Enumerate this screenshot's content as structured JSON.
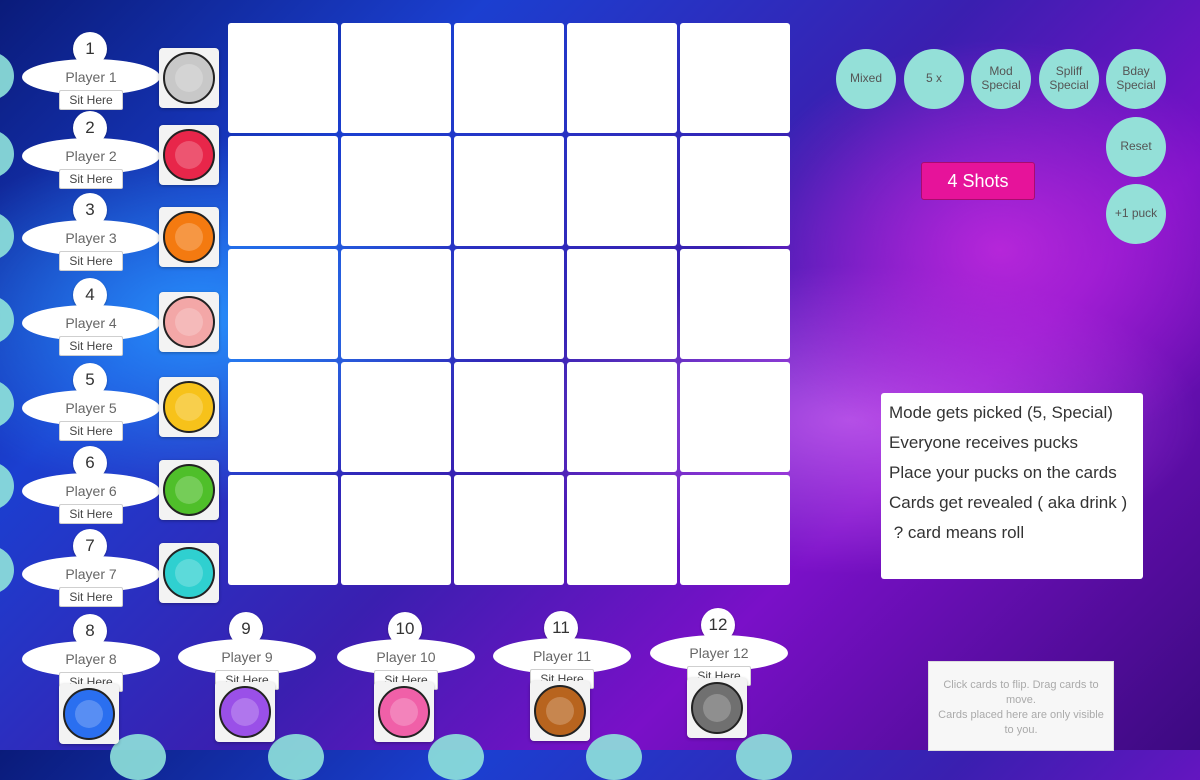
{
  "players": [
    {
      "num": "1",
      "name": "Player 1",
      "sit": "Sit Here",
      "color": "#c8c8c8"
    },
    {
      "num": "2",
      "name": "Player 2",
      "sit": "Sit Here",
      "color": "#e8264a"
    },
    {
      "num": "3",
      "name": "Player 3",
      "sit": "Sit Here",
      "color": "#f47a10"
    },
    {
      "num": "4",
      "name": "Player 4",
      "sit": "Sit Here",
      "color": "#f3a7a7"
    },
    {
      "num": "5",
      "name": "Player 5",
      "sit": "Sit Here",
      "color": "#f7c21a"
    },
    {
      "num": "6",
      "name": "Player 6",
      "sit": "Sit Here",
      "color": "#4fbf2a"
    },
    {
      "num": "7",
      "name": "Player 7",
      "sit": "Sit Here",
      "color": "#2fd0d0"
    },
    {
      "num": "8",
      "name": "Player 8",
      "sit": "Sit Here",
      "color": "#2a6ff0"
    },
    {
      "num": "9",
      "name": "Player 9",
      "sit": "Sit Here",
      "color": "#9a50e8"
    },
    {
      "num": "10",
      "name": "Player 10",
      "sit": "Sit Here",
      "color": "#f060a8"
    },
    {
      "num": "11",
      "name": "Player 11",
      "sit": "Sit Here",
      "color": "#b8641e"
    },
    {
      "num": "12",
      "name": "Player 12",
      "sit": "Sit Here",
      "color": "#707070"
    }
  ],
  "modes": {
    "mixed": "Mixed",
    "five": "5 x",
    "mod": "Mod\nSpecial",
    "spliff": "Spliff\nSpecial",
    "bday": "Bday\nSpecial",
    "reset": "Reset",
    "plus": "+1 puck"
  },
  "shots": "4 Shots",
  "rules": [
    "Mode gets picked (5, Special)",
    "Everyone receives pucks",
    "Place your pucks on the cards",
    "Cards get revealed ( aka drink )",
    " ? card means roll"
  ],
  "private_text": "Click cards to flip.    Drag cards to move.\nCards placed here are only visible to you.",
  "colors": {
    "accent": "#e6139a",
    "mode_button": "#94e0d8"
  }
}
